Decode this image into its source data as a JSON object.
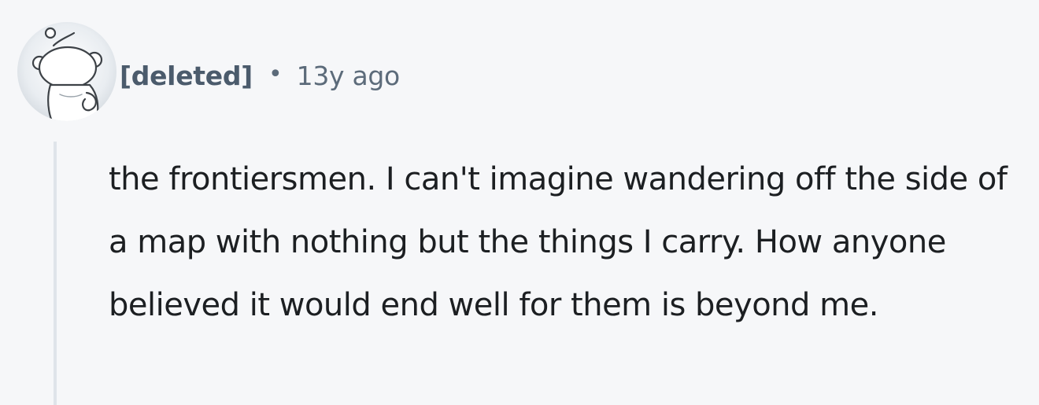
{
  "comment": {
    "author": "[deleted]",
    "separator": "•",
    "timestamp": "13y ago",
    "body": "the frontiersmen. I can't imagine wandering off the side of a map with nothing but the things I carry. How anyone believed it would end well for them is beyond me.",
    "avatar_icon": "snoo-avatar-icon"
  },
  "colors": {
    "background": "#f6f7f9",
    "author": "#4b5b6c",
    "meta": "#5c6b7a",
    "body_text": "#1c1f22",
    "thread_line": "#dfe4ea"
  }
}
